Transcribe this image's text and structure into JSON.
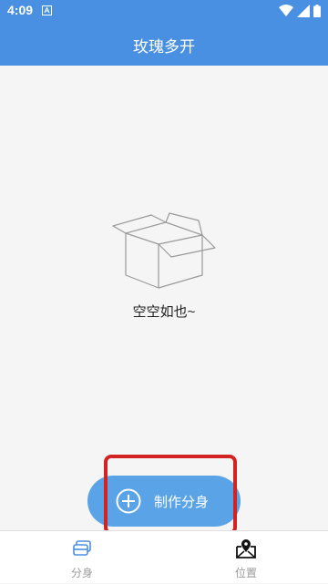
{
  "status_bar": {
    "time": "4:09",
    "icons": [
      "notification-a-icon",
      "wifi-icon",
      "signal-icon",
      "battery-icon"
    ]
  },
  "app_bar": {
    "title": "玫瑰多开"
  },
  "main": {
    "empty_icon": "empty-box-icon",
    "empty_text": "空空如也~"
  },
  "fab": {
    "icon": "plus-circle-icon",
    "label": "制作分身"
  },
  "bottom_nav": {
    "items": [
      {
        "label": "分身",
        "icon": "clone-icon"
      },
      {
        "label": "位置",
        "icon": "location-icon"
      }
    ]
  },
  "colors": {
    "primary": "#4a90e2",
    "fab": "#5aa3e6",
    "highlight": "#d32222",
    "nav_active": "#4a90e2"
  }
}
